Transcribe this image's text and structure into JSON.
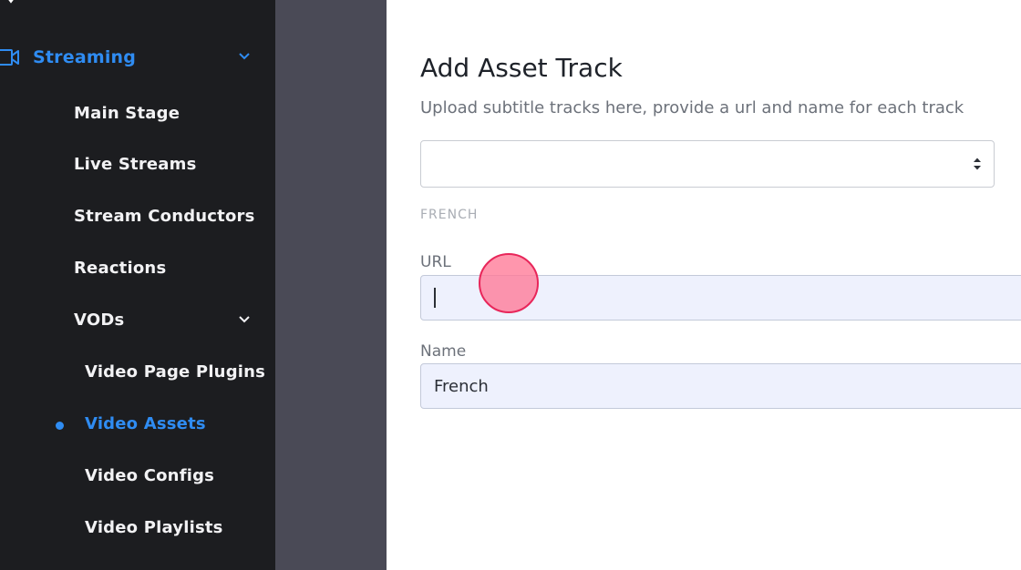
{
  "sidebar": {
    "streaming": {
      "label": "Streaming",
      "icon": "video-camera-icon"
    },
    "items": [
      {
        "label": "Main Stage"
      },
      {
        "label": "Live Streams"
      },
      {
        "label": "Stream Conductors"
      },
      {
        "label": "Reactions"
      },
      {
        "label": "VODs"
      }
    ],
    "vod_items": [
      {
        "label": "Video Page Plugins"
      },
      {
        "label": "Video Assets",
        "active": true
      },
      {
        "label": "Video Configs"
      },
      {
        "label": "Video Playlists"
      }
    ]
  },
  "panel": {
    "title": "Add Asset Track",
    "subtitle": "Upload subtitle tracks here, provide a url and name for each track",
    "select_value": "",
    "section_label": "FRENCH",
    "url_label": "URL",
    "url_value": "",
    "name_label": "Name",
    "name_value": "French"
  },
  "colors": {
    "sidebar_bg": "#1c1d20",
    "accent": "#2f8cf2",
    "overlay": "#4a4a56",
    "input_bg": "#eef1fd",
    "click_marker": "#e8265a"
  }
}
